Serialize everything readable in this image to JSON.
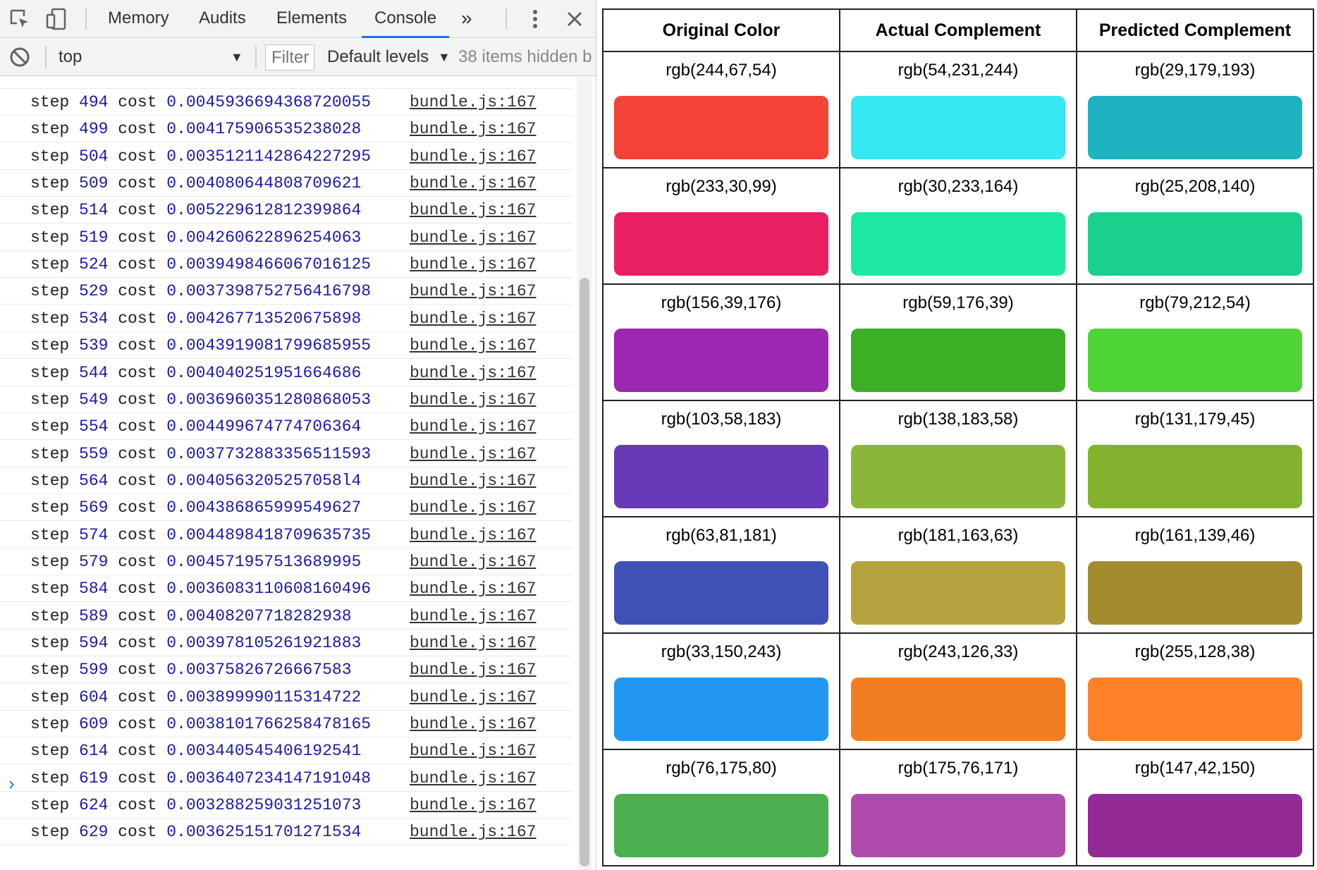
{
  "devtools": {
    "tabs": [
      "Memory",
      "Audits",
      "Elements",
      "Console"
    ],
    "active_tab": "Console",
    "more_tabs": "»",
    "context": "top",
    "filter_placeholder": "Filter",
    "levels": "Default levels",
    "hidden_items": "38 items hidden b",
    "prompt": "›",
    "logs": [
      {
        "step": "494",
        "cost": "0.0045936694368720055",
        "source": "bundle.js:167"
      },
      {
        "step": "499",
        "cost": "0.004175906535238028",
        "source": "bundle.js:167"
      },
      {
        "step": "504",
        "cost": "0.0035121142864227295",
        "source": "bundle.js:167"
      },
      {
        "step": "509",
        "cost": "0.004080644808709621",
        "source": "bundle.js:167"
      },
      {
        "step": "514",
        "cost": "0.005229612812399864",
        "source": "bundle.js:167"
      },
      {
        "step": "519",
        "cost": "0.004260622896254063",
        "source": "bundle.js:167"
      },
      {
        "step": "524",
        "cost": "0.0039498466067016125",
        "source": "bundle.js:167"
      },
      {
        "step": "529",
        "cost": "0.0037398752756416798",
        "source": "bundle.js:167"
      },
      {
        "step": "534",
        "cost": "0.004267713520675898",
        "source": "bundle.js:167"
      },
      {
        "step": "539",
        "cost": "0.0043919081799685955",
        "source": "bundle.js:167"
      },
      {
        "step": "544",
        "cost": "0.004040251951664686",
        "source": "bundle.js:167"
      },
      {
        "step": "549",
        "cost": "0.0036960351280868053",
        "source": "bundle.js:167"
      },
      {
        "step": "554",
        "cost": "0.004499674774706364",
        "source": "bundle.js:167"
      },
      {
        "step": "559",
        "cost": "0.0037732883356511593",
        "source": "bundle.js:167"
      },
      {
        "step": "564",
        "cost": "0.0040563205257058l4",
        "source": "bundle.js:167"
      },
      {
        "step": "569",
        "cost": "0.004386865999549627",
        "source": "bundle.js:167"
      },
      {
        "step": "574",
        "cost": "0.0044898418709635735",
        "source": "bundle.js:167"
      },
      {
        "step": "579",
        "cost": "0.004571957513689995",
        "source": "bundle.js:167"
      },
      {
        "step": "584",
        "cost": "0.0036083110608160496",
        "source": "bundle.js:167"
      },
      {
        "step": "589",
        "cost": "0.00408207718282938",
        "source": "bundle.js:167"
      },
      {
        "step": "594",
        "cost": "0.003978105261921883",
        "source": "bundle.js:167"
      },
      {
        "step": "599",
        "cost": "0.00375826726667583",
        "source": "bundle.js:167"
      },
      {
        "step": "604",
        "cost": "0.003899990115314722",
        "source": "bundle.js:167"
      },
      {
        "step": "609",
        "cost": "0.0038101766258478165",
        "source": "bundle.js:167"
      },
      {
        "step": "614",
        "cost": "0.003440545406192541",
        "source": "bundle.js:167"
      },
      {
        "step": "619",
        "cost": "0.0036407234147191048",
        "source": "bundle.js:167"
      },
      {
        "step": "624",
        "cost": "0.003288259031251073",
        "source": "bundle.js:167"
      },
      {
        "step": "629",
        "cost": "0.003625151701271534",
        "source": "bundle.js:167"
      }
    ]
  },
  "color_table": {
    "headers": [
      "Original Color",
      "Actual Complement",
      "Predicted Complement"
    ],
    "rows": [
      [
        {
          "label": "rgb(244,67,54)",
          "color": "#f44336"
        },
        {
          "label": "rgb(54,231,244)",
          "color": "#36e7f4"
        },
        {
          "label": "rgb(29,179,193)",
          "color": "#1db3c1"
        }
      ],
      [
        {
          "label": "rgb(233,30,99)",
          "color": "#e91e63"
        },
        {
          "label": "rgb(30,233,164)",
          "color": "#1ee9a4"
        },
        {
          "label": "rgb(25,208,140)",
          "color": "#19d08c"
        }
      ],
      [
        {
          "label": "rgb(156,39,176)",
          "color": "#9c27b0"
        },
        {
          "label": "rgb(59,176,39)",
          "color": "#3bb027"
        },
        {
          "label": "rgb(79,212,54)",
          "color": "#4fd436"
        }
      ],
      [
        {
          "label": "rgb(103,58,183)",
          "color": "#673ab7"
        },
        {
          "label": "rgb(138,183,58)",
          "color": "#8ab73a"
        },
        {
          "label": "rgb(131,179,45)",
          "color": "#83b32d"
        }
      ],
      [
        {
          "label": "rgb(63,81,181)",
          "color": "#3f51b5"
        },
        {
          "label": "rgb(181,163,63)",
          "color": "#b5a33f"
        },
        {
          "label": "rgb(161,139,46)",
          "color": "#a18b2e"
        }
      ],
      [
        {
          "label": "rgb(33,150,243)",
          "color": "#2196f3"
        },
        {
          "label": "rgb(243,126,33)",
          "color": "#f37e21"
        },
        {
          "label": "rgb(255,128,38)",
          "color": "#ff8026"
        }
      ],
      [
        {
          "label": "rgb(76,175,80)",
          "color": "#4caf50"
        },
        {
          "label": "rgb(175,76,171)",
          "color": "#af4cab"
        },
        {
          "label": "rgb(147,42,150)",
          "color": "#932a96"
        }
      ]
    ]
  }
}
